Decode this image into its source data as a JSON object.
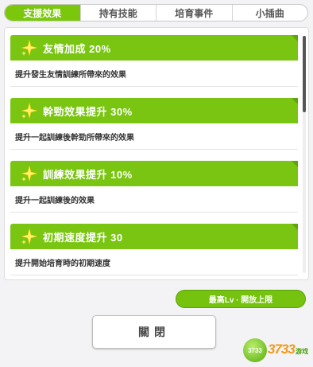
{
  "tabs": [
    {
      "label": "支援效果",
      "active": true
    },
    {
      "label": "持有技能",
      "active": false
    },
    {
      "label": "培育事件",
      "active": false
    },
    {
      "label": "小插曲",
      "active": false
    }
  ],
  "effects": [
    {
      "title": "友情加成 20%",
      "desc": "提升發生友情訓練所帶來的效果"
    },
    {
      "title": "幹勁效果提升 30%",
      "desc": "提升一起訓練後幹勁所帶來的效果"
    },
    {
      "title": "訓練效果提升 10%",
      "desc": "提升一起訓練後的效果"
    },
    {
      "title": "初期速度提升 30",
      "desc": "提升開始培育時的初期速度"
    }
  ],
  "buttons": {
    "max_level": "最高Lv · 開放上限",
    "close": "關閉"
  },
  "watermark": {
    "badge": "3733",
    "text": "3733",
    "sub": "游戏"
  },
  "colors": {
    "accent": "#79c511",
    "tab_active": "#7ac70c"
  }
}
